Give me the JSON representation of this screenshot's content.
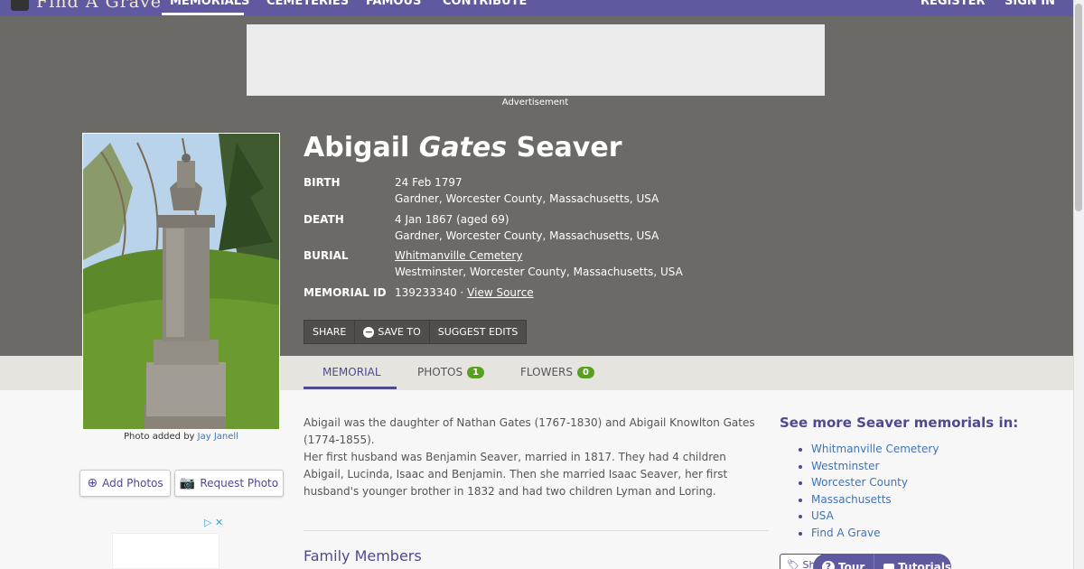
{
  "nav": {
    "logo": "Find A Grave",
    "items": [
      "MEMORIALS",
      "CEMETERIES",
      "FAMOUS",
      "CONTRIBUTE"
    ],
    "right": [
      "REGISTER",
      "SIGN IN"
    ]
  },
  "ad": {
    "label": "Advertisement"
  },
  "memorial": {
    "first": "Abigail",
    "maiden": "Gates",
    "last": "Seaver",
    "birth_label": "BIRTH",
    "birth_date": "24 Feb 1797",
    "birth_place": "Gardner, Worcester County, Massachusetts, USA",
    "death_label": "DEATH",
    "death_date": "4 Jan 1867 (aged 69)",
    "death_place": "Gardner, Worcester County, Massachusetts, USA",
    "burial_label": "BURIAL",
    "burial_cemetery": "Whitmanville Cemetery",
    "burial_place": "Westminster, Worcester County, Massachusetts, USA",
    "id_label": "MEMORIAL ID",
    "id_value": "139233340 ·",
    "view_source": "View Source"
  },
  "actions": {
    "share": "SHARE",
    "save": "SAVE TO",
    "suggest": "SUGGEST EDITS"
  },
  "tabs": [
    {
      "label": "MEMORIAL"
    },
    {
      "label": "PHOTOS",
      "count": "1"
    },
    {
      "label": "FLOWERS",
      "count": "0"
    }
  ],
  "photo": {
    "credit_prefix": "Photo added by",
    "credit_name": "Jay Janell"
  },
  "side_buttons": {
    "add": "Add Photos",
    "request": "Request Photo"
  },
  "bio": {
    "p1": "Abigail was the daughter of Nathan Gates (1767-1830) and Abigail Knowlton Gates (1774-1855).",
    "p2": "Her first husband was Benjamin Seaver, married in 1817. They had 4 children Abigail, Lucinda, Isaac and Benjamin. Then she married Isaac Seaver, her first husband's younger brother in 1832 and had two children Lyman and Loring."
  },
  "family_heading": "Family Members",
  "see_more": {
    "heading": "See more Seaver memorials in:",
    "links": [
      "Whitmanville Cemetery",
      "Westminster",
      "Worcester County",
      "Massachusetts",
      "USA",
      "Find A Grave"
    ]
  },
  "floating": {
    "share": "Sh",
    "tour": "Tour",
    "tutorials": "Tutorials"
  },
  "colors": {
    "nav": "#5f5aa0",
    "hero": "#6b6a66",
    "accent": "#4e4a8e",
    "badge": "#5aa020",
    "link": "#3e73b8"
  },
  "icons": [
    "plus-circle-icon",
    "camera-icon",
    "tag-icon",
    "question-icon",
    "video-icon",
    "ad-choices-icon"
  ]
}
